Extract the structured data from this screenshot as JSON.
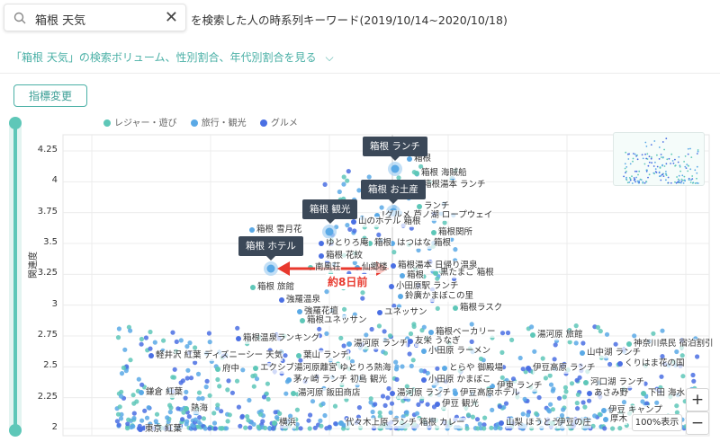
{
  "search": {
    "value": "箱根 天気",
    "clear_icon": "close-icon"
  },
  "header": {
    "title": "を検索した人の時系列キーワード(2019/10/14~2020/10/18)"
  },
  "detail_link": {
    "label": "「箱根 天気」の検索ボリューム、性別割合、年代別割合を見る"
  },
  "metric_button": {
    "label": "指標変更"
  },
  "legend": [
    {
      "label": "レジャー・遊び",
      "color": "#5ec7b8"
    },
    {
      "label": "旅行・観光",
      "color": "#5aa9e6"
    },
    {
      "label": "グルメ",
      "color": "#4a6fe3"
    }
  ],
  "chart_data": {
    "type": "scatter",
    "ylabel": "関連度",
    "ylim": [
      2,
      4.25
    ],
    "yticks": [
      "4.25",
      "4",
      "3.75",
      "3.5",
      "3.25",
      "3",
      "2.75",
      "2.5",
      "2.25",
      "2"
    ],
    "time_range_label": "約8日前",
    "highlighted": [
      {
        "label": "箱根 ランチ",
        "y": 4.1
      },
      {
        "label": "箱根 お土産",
        "y": 3.76
      },
      {
        "label": "箱根 観光",
        "y": 3.59
      },
      {
        "label": "箱根 ホテル",
        "y": 3.28
      }
    ],
    "keywords": [
      {
        "label": "箱根 海賊船",
        "y": 4.22
      },
      {
        "label": "箱根",
        "y": 4.15
      },
      {
        "label": "箱根湯本 ランチ",
        "y": 3.97
      },
      {
        "label": "ランチ",
        "y": 3.86
      },
      {
        "label": "!グルメ 芦ノ湖 ロープウェイ",
        "y": 3.76
      },
      {
        "label": "山のホテル 箱根",
        "y": 3.69
      },
      {
        "label": "箱根関所",
        "y": 3.6
      },
      {
        "label": "箱根 雪月花",
        "y": 3.6
      },
      {
        "label": "ゆとりろ庵",
        "y": 3.5
      },
      {
        "label": "箱根",
        "y": 3.5
      },
      {
        "label": "はつはな 箱根",
        "y": 3.5
      },
      {
        "label": "箱根 花紋",
        "y": 3.41
      },
      {
        "label": "南風荘",
        "y": 3.33
      },
      {
        "label": "仙郷楼",
        "y": 3.34
      },
      {
        "label": "箱根湯本 日帰り温泉",
        "y": 3.34
      },
      {
        "label": "黒たまご 箱根",
        "y": 3.27
      },
      {
        "label": "箱根",
        "y": 3.26
      },
      {
        "label": "小田原駅 ランチ",
        "y": 3.15
      },
      {
        "label": "箱根 旅館",
        "y": 3.14
      },
      {
        "label": "鈴廣かまぼこの里",
        "y": 3.07
      },
      {
        "label": "強羅温泉",
        "y": 3.05
      },
      {
        "label": "箱根ラスク",
        "y": 2.98
      },
      {
        "label": "強羅花壇",
        "y": 2.96
      },
      {
        "label": "ユネッサン",
        "y": 2.96
      },
      {
        "label": "箱根ユネッサン",
        "y": 2.89
      },
      {
        "label": "箱根ベーカリー",
        "y": 2.81
      },
      {
        "label": "箱根温泉ランキング",
        "y": 2.74
      },
      {
        "label": "湯河原 旅館",
        "y": 2.75
      },
      {
        "label": "湯河原 ランチ",
        "y": 2.71
      },
      {
        "label": "友栄 うなぎ",
        "y": 2.73
      },
      {
        "label": "神奈川県民 宿泊割引",
        "y": 2.7
      },
      {
        "label": "山中湖 ランチ",
        "y": 2.64
      },
      {
        "label": "軽井沢 紅葉 ディズニーシー 天気",
        "y": 2.63
      },
      {
        "label": "葉山 ランチ",
        "y": 2.62
      },
      {
        "label": "小田原 ラーメン",
        "y": 2.65
      },
      {
        "label": "くりはま花の国",
        "y": 2.57
      },
      {
        "label": "エクシブ湯河原離宮 ゆとりろ熱海",
        "y": 2.55
      },
      {
        "label": "とらや 御殿場",
        "y": 2.55
      },
      {
        "label": "伊豆高原 ランチ",
        "y": 2.55
      },
      {
        "label": "府中",
        "y": 2.52
      },
      {
        "label": "茅ヶ崎 ランチ 初島 観光",
        "y": 2.47
      },
      {
        "label": "小田原 かまぼこ",
        "y": 2.48
      },
      {
        "label": "河口湖 ランチ",
        "y": 2.41
      },
      {
        "label": "伊東 ランチ",
        "y": 2.39
      },
      {
        "label": "湯河原 ランチ",
        "y": 2.33
      },
      {
        "label": "湯河原 飯田商店",
        "y": 2.33
      },
      {
        "label": "伊豆高原ホテル",
        "y": 2.32
      },
      {
        "label": "あさみ野",
        "y": 2.33
      },
      {
        "label": "下田 海水",
        "y": 2.32
      },
      {
        "label": "鎌倉 紅葉",
        "y": 2.34
      },
      {
        "label": "伊豆 観光",
        "y": 2.24
      },
      {
        "label": "熱海",
        "y": 2.2
      },
      {
        "label": "伊豆 キャンプ",
        "y": 2.1
      },
      {
        "label": "東京 紅葉",
        "y": 2.03
      },
      {
        "label": "横浜",
        "y": 2.06
      },
      {
        "label": "代々木上原 ランチ 箱根 カレー",
        "y": 2.06
      },
      {
        "label": "山梨 ほうとう",
        "y": 2.05
      },
      {
        "label": "伊豆の庄",
        "y": 2.06
      },
      {
        "label": "厚木",
        "y": 2.06
      }
    ]
  },
  "zoom": {
    "in_label": "+",
    "out_label": "−",
    "level_label": "100%表示"
  }
}
